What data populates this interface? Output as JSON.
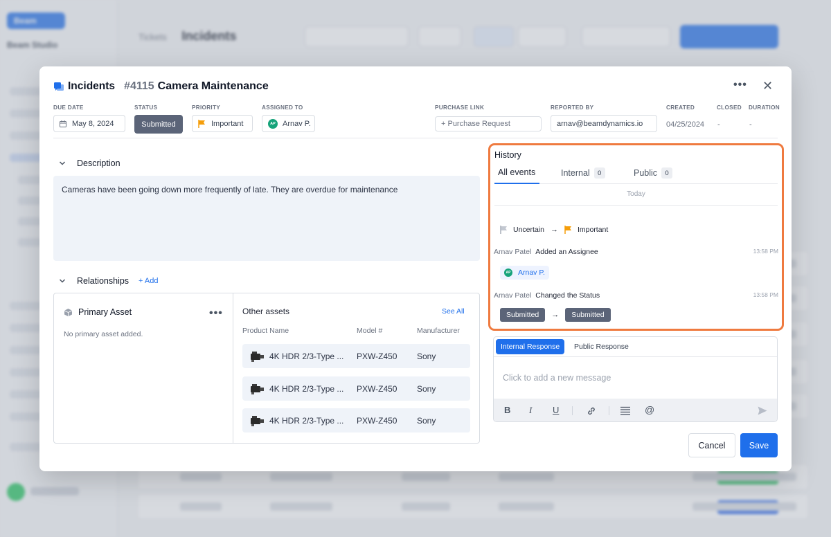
{
  "background": {
    "brand": "Beam",
    "org_name": "Beam Studio",
    "breadcrumb_parent": "Tickets",
    "breadcrumb_current": "Incidents"
  },
  "modal": {
    "section": "Incidents",
    "ticket_number": "#4115",
    "ticket_title": "Camera Maintenance",
    "more_icon": "more-horizontal-icon",
    "close_icon": "close-icon",
    "fields": {
      "due_date_label": "DUE DATE",
      "due_date_value": "May 8, 2024",
      "status_label": "STATUS",
      "status_value": "Submitted",
      "priority_label": "PRIORITY",
      "priority_value": "Important",
      "assigned_label": "ASSIGNED TO",
      "assigned_initials": "AP",
      "assigned_value": "Arnav P.",
      "purchase_label": "PURCHASE LINK",
      "purchase_value": "+ Purchase Request",
      "reported_label": "REPORTED BY",
      "reported_value": "arnav@beamdynamics.io",
      "created_label": "CREATED",
      "created_value": "04/25/2024",
      "closed_label": "CLOSED",
      "closed_value": "-",
      "duration_label": "DURATION",
      "duration_value": "-"
    },
    "description": {
      "heading": "Description",
      "text": "Cameras have been going down more frequently of late. They are overdue for maintenance"
    },
    "relationships": {
      "heading": "Relationships",
      "add_label": "+ Add",
      "primary_asset_title": "Primary Asset",
      "primary_asset_empty": "No primary asset added.",
      "other_assets_title": "Other assets",
      "see_all": "See All",
      "columns": [
        "Product Name",
        "Model #",
        "Manufacturer"
      ],
      "rows": [
        {
          "name": "4K HDR 2/3-Type ...",
          "model": "PXW-Z450",
          "manufacturer": "Sony"
        },
        {
          "name": "4K HDR 2/3-Type ...",
          "model": "PXW-Z450",
          "manufacturer": "Sony"
        },
        {
          "name": "4K HDR 2/3-Type ...",
          "model": "PXW-Z450",
          "manufacturer": "Sony"
        }
      ]
    },
    "history": {
      "title": "History",
      "tabs": [
        {
          "label": "All events",
          "count": ""
        },
        {
          "label": "Internal",
          "count": "0"
        },
        {
          "label": "Public",
          "count": "0"
        }
      ],
      "today_label": "Today",
      "priority_change": {
        "from": "Uncertain",
        "to": "Important"
      },
      "event1": {
        "user": "Arnav Patel",
        "action": "Added an Assignee",
        "time": "13:58 PM",
        "assignee_initials": "AP",
        "assignee": "Arnav P."
      },
      "event2": {
        "user": "Arnav Patel",
        "action": "Changed the Status",
        "time": "13:58 PM",
        "from": "Submitted",
        "to": "Submitted"
      }
    },
    "composer": {
      "tab_internal": "Internal Response",
      "tab_public": "Public Response",
      "placeholder": "Click to add a new message",
      "toolbar_icons": [
        "bold-icon",
        "italic-icon",
        "underline-icon",
        "link-icon",
        "list-icon",
        "mention-icon",
        "send-icon"
      ]
    },
    "buttons": {
      "cancel": "Cancel",
      "save": "Save"
    },
    "colors": {
      "accent": "#1f6feb",
      "status": "#5b6478",
      "highlight": "#ef7a3f",
      "priority_flag": "#f59e0b"
    }
  }
}
